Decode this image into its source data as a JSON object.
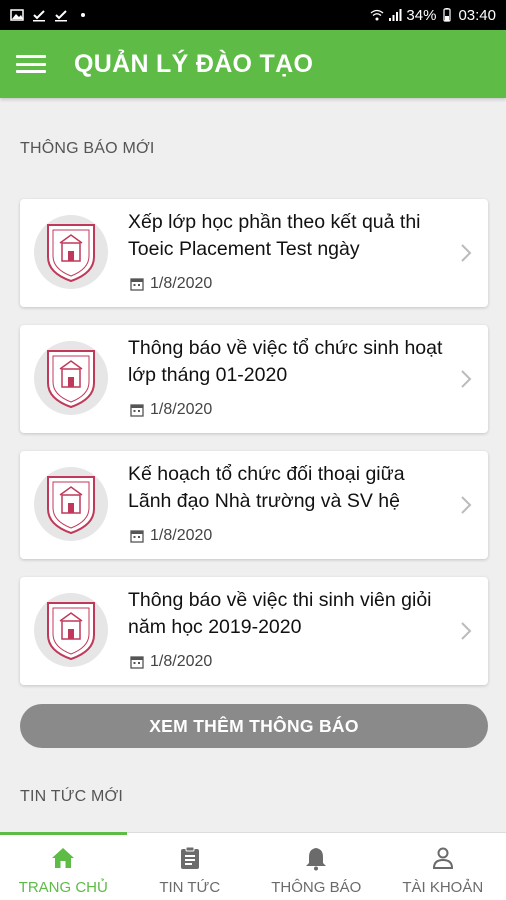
{
  "status_bar": {
    "battery": "34%",
    "time": "03:40",
    "icons": [
      "gallery-icon",
      "check-icon",
      "check-icon",
      "dot-icon",
      "wifi-icon",
      "signal-icon",
      "battery-icon"
    ]
  },
  "header": {
    "title": "QUẢN LÝ ĐÀO TẠO",
    "menu_icon": "hamburger-menu-icon"
  },
  "notices": {
    "section_title": "THÔNG BÁO MỚI",
    "items": [
      {
        "title": "Xếp lớp học phần theo kết quả thi Toeic Placement Test ngày",
        "date": "1/8/2020"
      },
      {
        "title": "Thông báo về việc tổ chức sinh hoạt lớp tháng 01-2020",
        "date": "1/8/2020"
      },
      {
        "title": "Kế hoạch tổ chức đối thoại giữa Lãnh đạo Nhà trường và SV hệ",
        "date": "1/8/2020"
      },
      {
        "title": "Thông báo về việc thi sinh viên giỏi năm học 2019-2020",
        "date": "1/8/2020"
      }
    ],
    "more_button": "XEM THÊM THÔNG BÁO"
  },
  "news": {
    "section_title": "TIN TỨC MỚI"
  },
  "bottom_nav": {
    "items": [
      {
        "label": "TRANG CHỦ",
        "icon": "home-icon",
        "active": true
      },
      {
        "label": "TIN TỨC",
        "icon": "clipboard-icon",
        "active": false
      },
      {
        "label": "THÔNG BÁO",
        "icon": "bell-icon",
        "active": false
      },
      {
        "label": "TÀI KHOẢN",
        "icon": "person-icon",
        "active": false
      }
    ]
  },
  "colors": {
    "primary": "#5dbb46",
    "button_gray": "#8a8a8a",
    "background": "#efefef"
  }
}
